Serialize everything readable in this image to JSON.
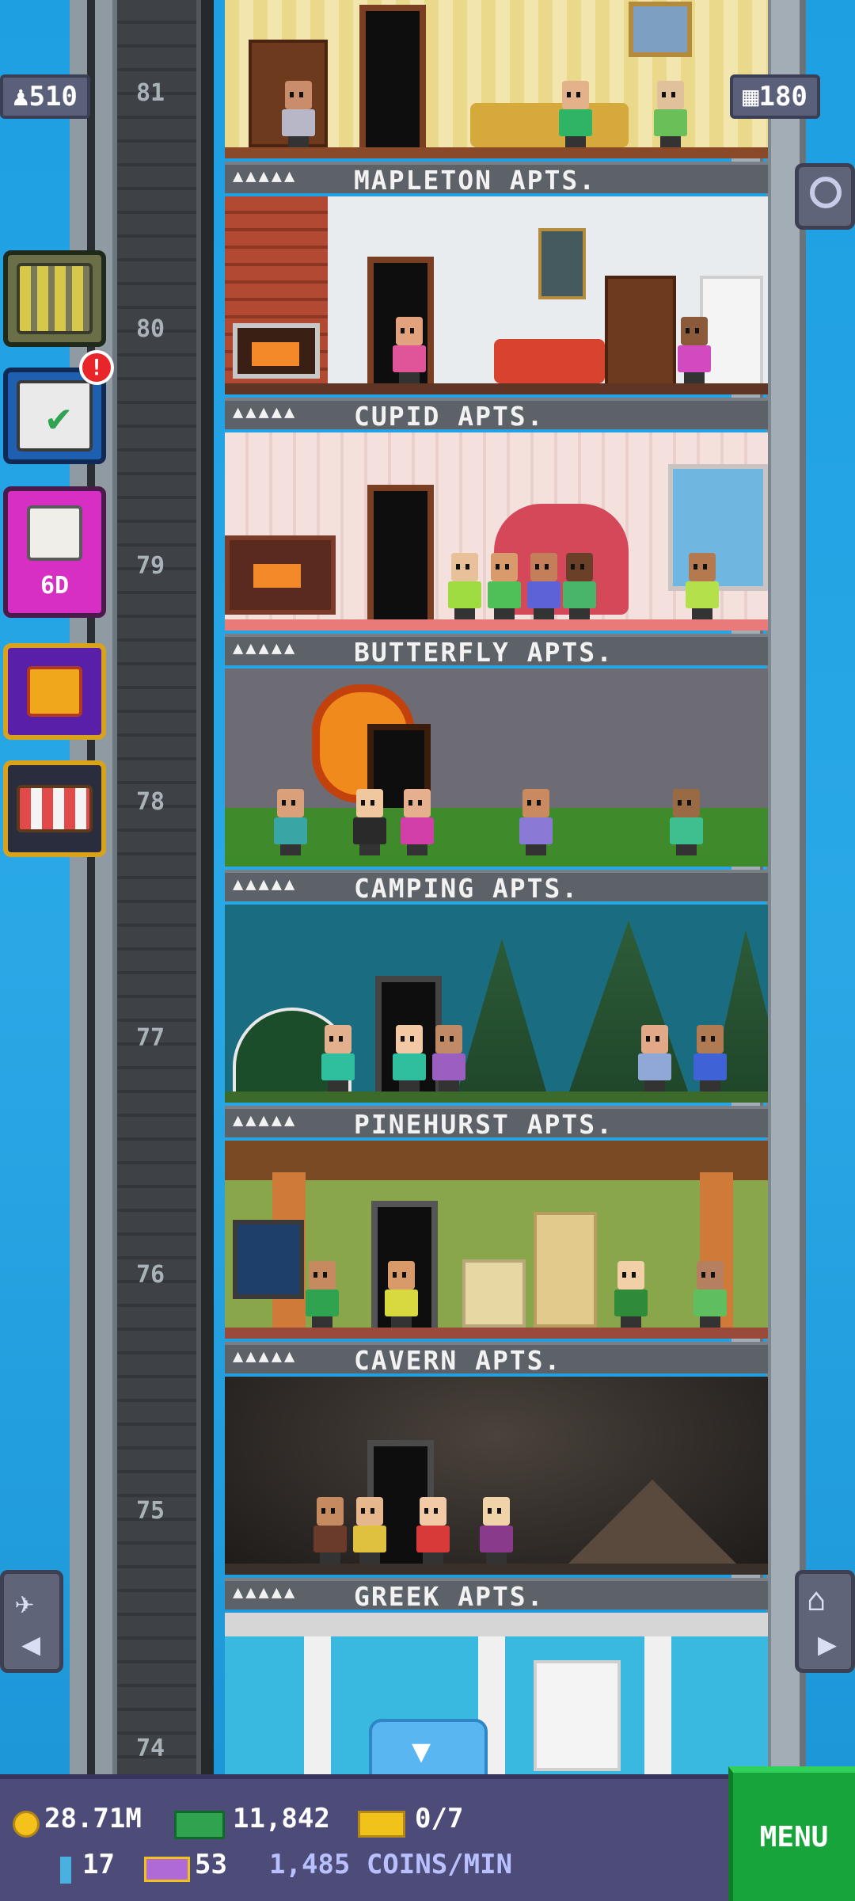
{
  "header": {
    "population": "510",
    "floors_count": "180"
  },
  "floors": [
    {
      "number": "81",
      "name": "MAPLETON APTS.",
      "stars": "▲▲▲▲▲"
    },
    {
      "number": "80",
      "name": "CUPID APTS.",
      "stars": "▲▲▲▲▲"
    },
    {
      "number": "79",
      "name": "BUTTERFLY APTS.",
      "stars": "▲▲▲▲▲"
    },
    {
      "number": "78",
      "name": "CAMPING APTS.",
      "stars": "▲▲▲▲▲"
    },
    {
      "number": "77",
      "name": "PINEHURST APTS.",
      "stars": "▲▲▲▲▲"
    },
    {
      "number": "76",
      "name": "CAVERN APTS.",
      "stars": "▲▲▲▲▲"
    },
    {
      "number": "75",
      "name": "GREEK APTS.",
      "stars": "▲▲▲▲▲"
    },
    {
      "number": "74",
      "name": "",
      "stars": ""
    }
  ],
  "sidebar": {
    "dice_timer": "6D"
  },
  "hud": {
    "coins": "28.71M",
    "bux": "11,842",
    "tickets": "0/7",
    "keys": "17",
    "vip": "53",
    "rate": "1,485 COINS/MIN",
    "menu_label": "MENU"
  },
  "colors": {
    "sky": "#2b9fdc",
    "hud_bg": "#4d4b78",
    "menu_green": "#17a53b",
    "label_bar": "#5d6268"
  }
}
